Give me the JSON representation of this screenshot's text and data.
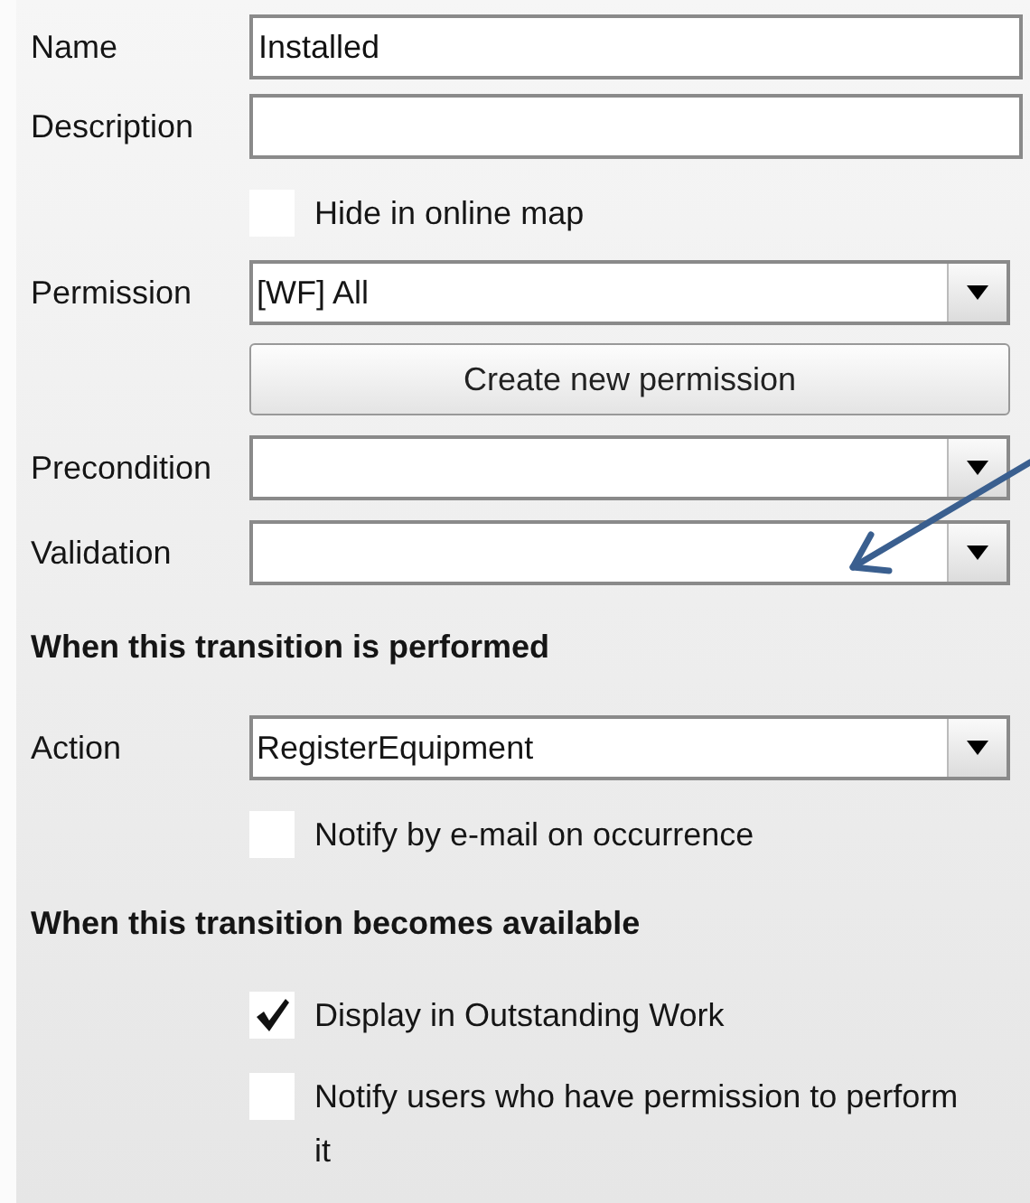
{
  "rows": [
    {
      "kind": "text",
      "label": "Name",
      "value": "Installed"
    },
    {
      "kind": "text",
      "label": "Description"
    },
    {
      "kind": "checkbox",
      "text": "Hide in online map",
      "checked": false
    },
    {
      "kind": "dropdown",
      "label": "Permission",
      "value": "[WF] All"
    },
    {
      "kind": "button",
      "text": "Create new permission"
    },
    {
      "kind": "dropdown",
      "label": "Precondition"
    },
    {
      "kind": "dropdown",
      "label": "Validation"
    },
    {
      "kind": "heading",
      "text": "When this transition is performed"
    },
    {
      "kind": "dropdown",
      "label": "Action",
      "value": "RegisterEquipment"
    },
    {
      "kind": "checkbox",
      "text": "Notify by e-mail on occurrence",
      "checked": false
    },
    {
      "kind": "heading",
      "text": "When this transition becomes available"
    },
    {
      "kind": "checkbox",
      "text": "Display in Outstanding Work",
      "checked": true
    },
    {
      "kind": "checkbox",
      "text": "Notify users who have permission to perform it",
      "checked": false
    }
  ]
}
